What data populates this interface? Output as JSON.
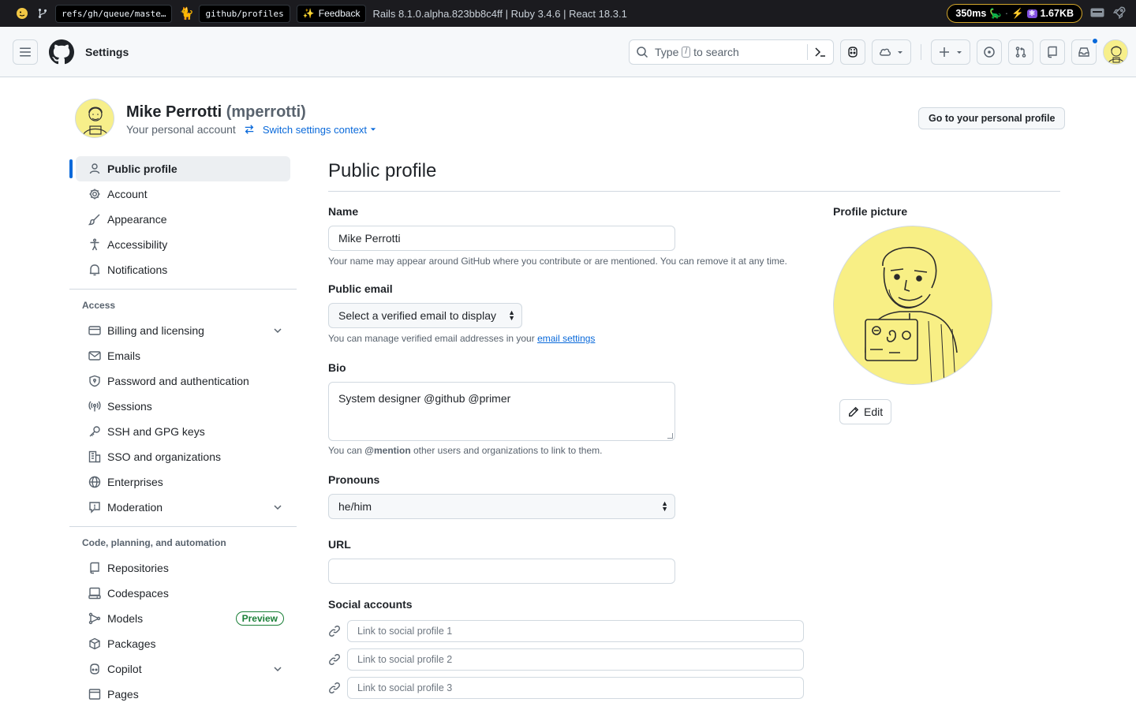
{
  "devbar": {
    "branch": "refs/gh/queue/maste…",
    "repo": "github/profiles",
    "feedback": "Feedback",
    "version": "Rails 8.1.0.alpha.823bb8c4ff | Ruby 3.4.6 | React 18.3.1",
    "time": "350ms",
    "size": "1.67KB"
  },
  "header": {
    "title": "Settings",
    "search_before": "Type",
    "search_key": "/",
    "search_after": "to search"
  },
  "account": {
    "name": "Mike Perrotti",
    "login": "(mperrotti)",
    "subtitle": "Your personal account",
    "switch": "Switch settings context",
    "profile_button": "Go to your personal profile"
  },
  "sidebar": {
    "items_top": [
      {
        "label": "Public profile",
        "icon": "person-icon"
      },
      {
        "label": "Account",
        "icon": "gear-icon"
      },
      {
        "label": "Appearance",
        "icon": "paintbrush-icon"
      },
      {
        "label": "Accessibility",
        "icon": "accessibility-icon"
      },
      {
        "label": "Notifications",
        "icon": "bell-icon"
      }
    ],
    "access_heading": "Access",
    "items_access": [
      {
        "label": "Billing and licensing",
        "icon": "credit-card-icon"
      },
      {
        "label": "Emails",
        "icon": "mail-icon"
      },
      {
        "label": "Password and authentication",
        "icon": "shield-lock-icon"
      },
      {
        "label": "Sessions",
        "icon": "broadcast-icon"
      },
      {
        "label": "SSH and GPG keys",
        "icon": "key-icon"
      },
      {
        "label": "SSO and organizations",
        "icon": "organization-icon"
      },
      {
        "label": "Enterprises",
        "icon": "globe-icon"
      },
      {
        "label": "Moderation",
        "icon": "report-icon"
      }
    ],
    "code_heading": "Code, planning, and automation",
    "items_code": [
      {
        "label": "Repositories",
        "icon": "repo-icon"
      },
      {
        "label": "Codespaces",
        "icon": "codespaces-icon"
      },
      {
        "label": "Models",
        "icon": "models-icon",
        "badge": "Preview"
      },
      {
        "label": "Packages",
        "icon": "package-icon"
      },
      {
        "label": "Copilot",
        "icon": "copilot-icon"
      },
      {
        "label": "Pages",
        "icon": "browser-icon"
      }
    ]
  },
  "main": {
    "title": "Public profile",
    "name_label": "Name",
    "name_value": "Mike Perrotti",
    "name_note": "Your name may appear around GitHub where you contribute or are mentioned. You can remove it at any time.",
    "email_label": "Public email",
    "email_select": "Select a verified email to display",
    "email_note_before": "You can manage verified email addresses in your",
    "email_note_link": "email settings",
    "bio_label": "Bio",
    "bio_value": "System designer @github @primer",
    "bio_note_before": "You can",
    "bio_note_mention": "@mention",
    "bio_note_after": "other users and organizations to link to them.",
    "pronouns_label": "Pronouns",
    "pronouns_value": "he/him",
    "url_label": "URL",
    "url_value": "",
    "social_label": "Social accounts",
    "social_placeholders": [
      "Link to social profile 1",
      "Link to social profile 2",
      "Link to social profile 3"
    ],
    "picture_label": "Profile picture",
    "edit_label": "Edit"
  },
  "colors": {
    "accent": "#0969da",
    "avatar_bg": "#f8ef85",
    "success": "#1a7f37"
  }
}
